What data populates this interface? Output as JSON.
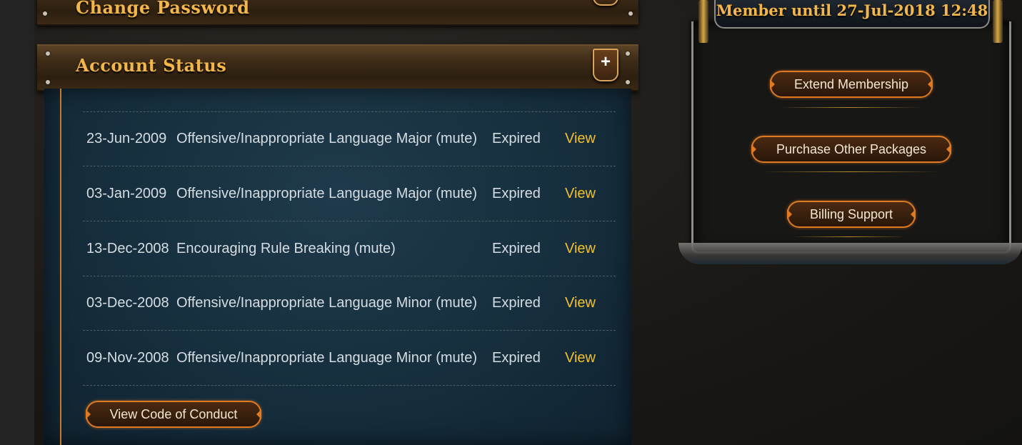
{
  "sections": {
    "change_password": {
      "title": "Change Password"
    },
    "account_status": {
      "title": "Account Status",
      "toggle_label": "+",
      "offences": [
        {
          "date": "23-Jun-2009",
          "offence": "Offensive/Inappropriate Language Major (mute)",
          "status": "Expired",
          "action": "View"
        },
        {
          "date": "03-Jan-2009",
          "offence": "Offensive/Inappropriate Language Major (mute)",
          "status": "Expired",
          "action": "View"
        },
        {
          "date": "13-Dec-2008",
          "offence": "Encouraging Rule Breaking (mute)",
          "status": "Expired",
          "action": "View"
        },
        {
          "date": "03-Dec-2008",
          "offence": "Offensive/Inappropriate Language Minor (mute)",
          "status": "Expired",
          "action": "View"
        },
        {
          "date": "09-Nov-2008",
          "offence": "Offensive/Inappropriate Language Minor (mute)",
          "status": "Expired",
          "action": "View"
        }
      ],
      "code_of_conduct_button": "View Code of Conduct"
    }
  },
  "membership": {
    "banner": "Member until 27-Jul-2018 12:48",
    "buttons": [
      "Extend Membership",
      "Purchase Other Packages",
      "Billing Support"
    ]
  },
  "colors": {
    "accent_gold": "#f2b64a",
    "link_yellow": "#f0c030",
    "button_border": "#e07a22",
    "panel_blue": "#17303f"
  }
}
